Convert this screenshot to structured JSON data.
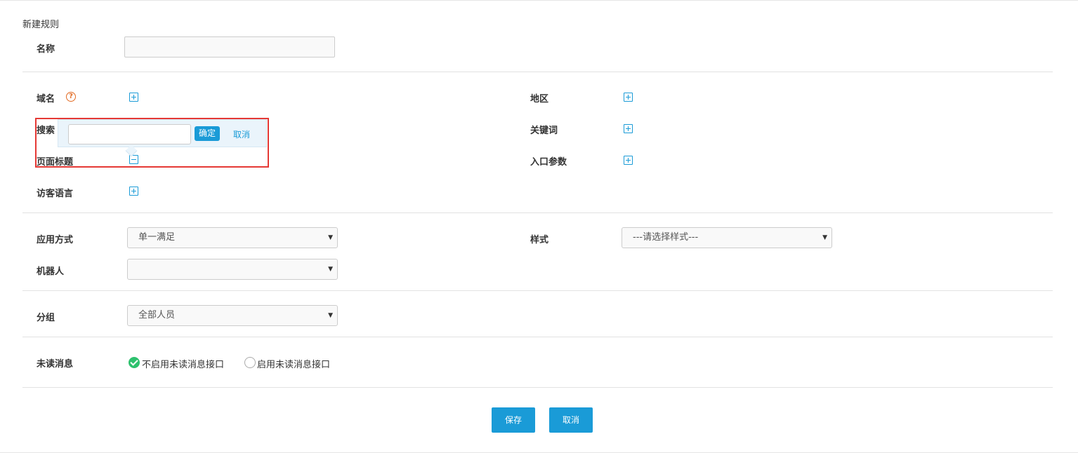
{
  "page_title": "新建规则",
  "name_field": {
    "label": "名称",
    "value": ""
  },
  "conditions": {
    "domain": {
      "label": "域名",
      "help": "?"
    },
    "search": {
      "label": "搜索"
    },
    "page_title": {
      "label": "页面标题"
    },
    "visitor_language": {
      "label": "访客语言"
    },
    "region": {
      "label": "地区"
    },
    "keyword": {
      "label": "关键词"
    },
    "entry_params": {
      "label": "入口参数"
    }
  },
  "popup": {
    "value": "",
    "ok_label": "确定",
    "cancel_label": "取消"
  },
  "apply_mode": {
    "label": "应用方式",
    "value": "单一满足"
  },
  "style": {
    "label": "样式",
    "value": "---请选择样式---"
  },
  "robot": {
    "label": "机器人",
    "value": ""
  },
  "group": {
    "label": "分组",
    "value": "全部人员"
  },
  "unread": {
    "label": "未读消息",
    "options": [
      {
        "label": "不启用未读消息接口",
        "selected": true
      },
      {
        "label": "启用未读消息接口",
        "selected": false
      }
    ]
  },
  "actions": {
    "save_label": "保存",
    "cancel_label": "取消"
  },
  "colors": {
    "accent": "#1a9bd7",
    "highlight_border": "#e53935",
    "radio_checked": "#2ec16e",
    "help": "#e26a22"
  }
}
